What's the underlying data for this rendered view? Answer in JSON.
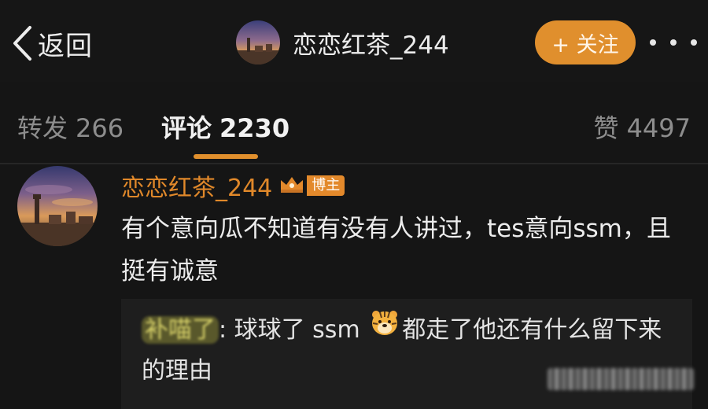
{
  "header": {
    "back_label": "返回",
    "username": "恋恋红茶_244",
    "follow_label": "+ 关注"
  },
  "tabs": {
    "repost": {
      "label": "转发",
      "count": "266"
    },
    "comments": {
      "label": "评论",
      "count": "2230"
    },
    "likes": {
      "label": "赞",
      "count": "4497"
    }
  },
  "comment": {
    "username": "恋恋红茶_244",
    "badge": "博主",
    "text": "有个意向瓜不知道有没有人讲过，tes意向ssm，且挺有诚意",
    "reply": {
      "username": "补喵了",
      "separator": ":",
      "text_before_emoji": " 球球了 ssm ",
      "emoji": "tiger-face",
      "text_after_emoji": "都走了他还有什么留下来的理由"
    }
  },
  "colors": {
    "accent": "#e08f2d",
    "username": "#e0882a",
    "background": "#151515"
  }
}
